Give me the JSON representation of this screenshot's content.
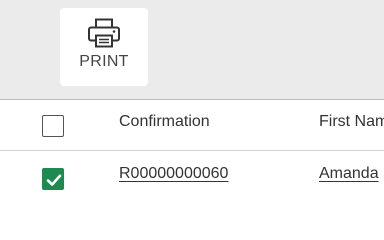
{
  "toolbar": {
    "print_label": "PRINT",
    "print_icon": "printer-icon"
  },
  "table": {
    "columns": [
      "Confirmation",
      "First Name"
    ],
    "select_all_checked": false,
    "rows": [
      {
        "checked": true,
        "confirmation": "R00000000060",
        "first_name": "Amanda"
      }
    ]
  },
  "colors": {
    "toolbar_background": "#ebebeb",
    "checkbox_checked": "#1e8a50",
    "text": "#333333"
  }
}
